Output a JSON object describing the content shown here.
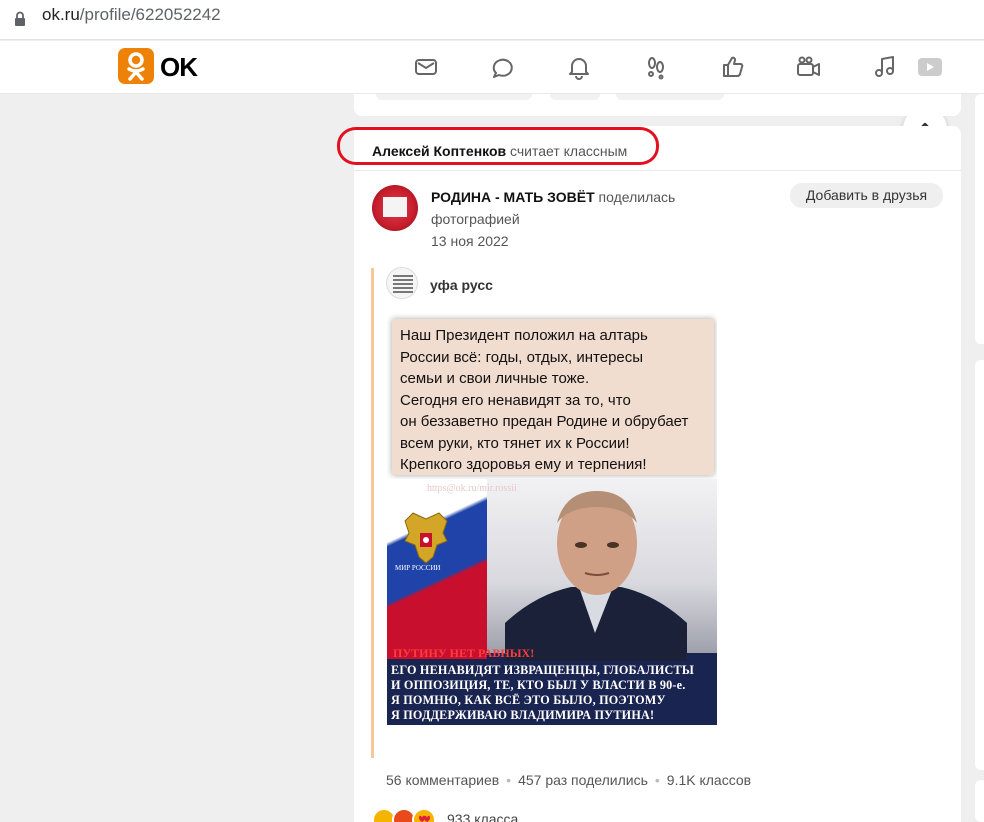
{
  "browser": {
    "url_domain": "ok.ru",
    "url_path": "/profile/622052242"
  },
  "header": {
    "logo_text": "OK",
    "nav_icons": [
      "mail-icon",
      "discussions-icon",
      "notifications-icon",
      "guests-icon",
      "likes-icon",
      "video-icon",
      "music-icon",
      "video-play-icon"
    ]
  },
  "post": {
    "actor_name": "Алексей Коптенков",
    "actor_action": "считает классным",
    "publisher_name": "РОДИНА - МАТЬ ЗОВЁТ",
    "publisher_action": "поделилась фотографией",
    "date": "13 ноя 2022",
    "add_friend_label": "Добавить в друзья",
    "original_author": "уфа русс",
    "image": {
      "note_text": "Наш Президент положил на алтарь\nРоссии всё: годы, отдых, интересы\nсемьи и свои личные тоже.\nСегодня его ненавидят за то, что\nон беззаветно предан Родине и обрубает\nвсем руки, кто тянет их к России!\nКрепкого здоровья ему и терпения!",
      "watermark": "https@ok.ru/mir.rossii",
      "flag_caption": "МИР РОССИИ",
      "slogan": "ПУТИНУ НЕТ РАВНЫХ!",
      "bottom_text": "ЕГО НЕНАВИДЯТ ИЗВРАЩЕНЦЫ, ГЛОБАЛИСТЫ\nИ ОППОЗИЦИЯ, ТЕ, КТО БЫЛ У ВЛАСТИ В 90-е.\nЯ ПОМНЮ, КАК ВСЁ ЭТО БЫЛО, ПОЭТОМУ\nЯ ПОДДЕРЖИВАЮ ВЛАДИМИРА ПУТИНА!"
    },
    "comments": "56 комментариев",
    "shares": "457 раз поделились",
    "classes": "9.1K классов",
    "reactions_count": "933 класса"
  },
  "colors": {
    "ok_orange": "#ee8208",
    "highlight_red": "#e3101f",
    "reshare_bar": "#f7c79b"
  }
}
